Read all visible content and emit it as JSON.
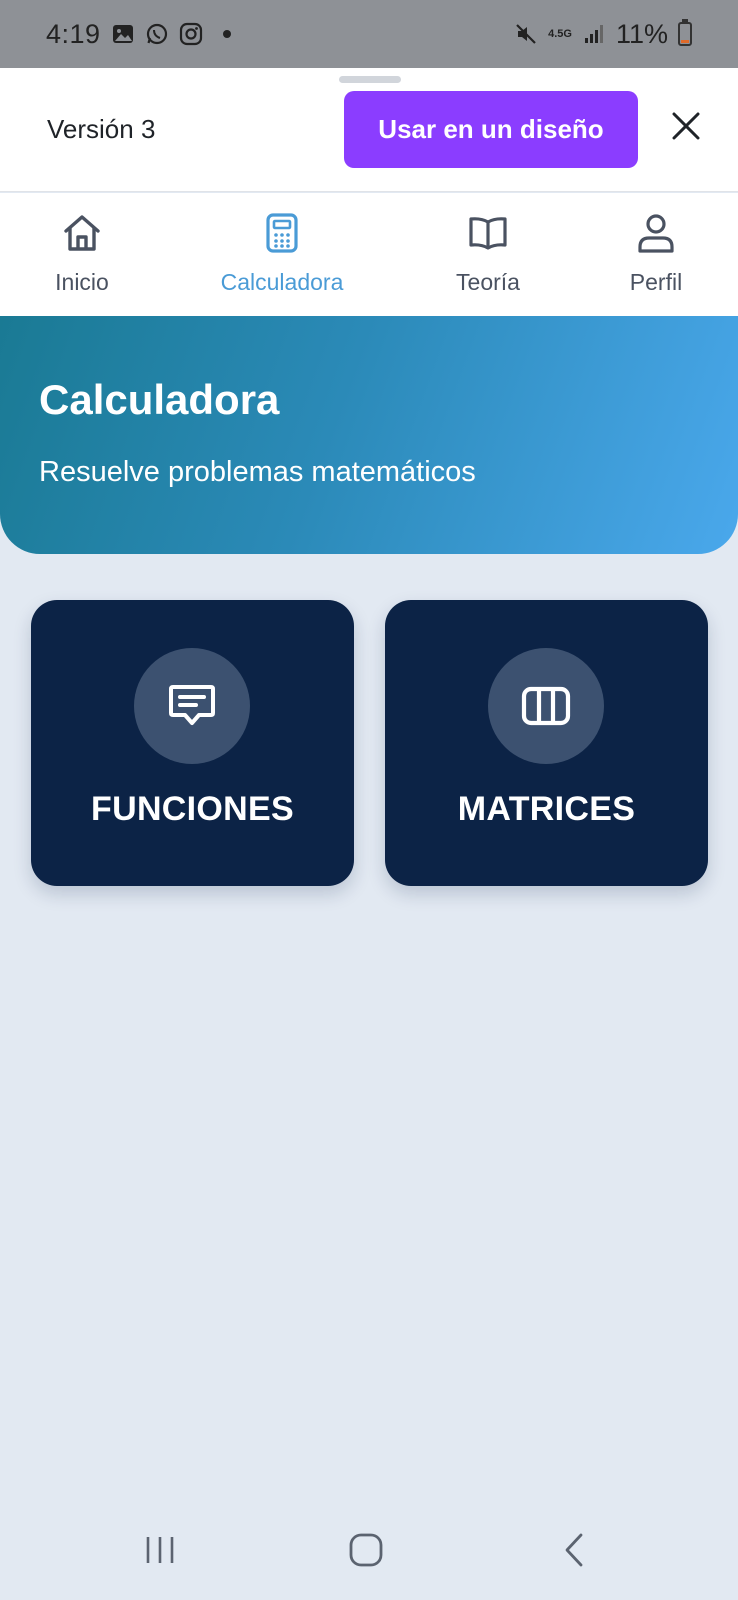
{
  "status_bar": {
    "time": "4:19",
    "network": "4.5G",
    "battery": "11%",
    "icons": [
      "gallery-icon",
      "whatsapp-icon",
      "instagram-icon",
      "notification-dot",
      "mute-icon",
      "signal-icon",
      "battery-icon"
    ]
  },
  "header": {
    "version_label": "Versión 3",
    "use_button_label": "Usar en un diseño",
    "accent_color": "#8b3dff"
  },
  "tabs": [
    {
      "label": "Inicio",
      "icon": "home-icon",
      "active": false
    },
    {
      "label": "Calculadora",
      "icon": "calculator-icon",
      "active": true
    },
    {
      "label": "Teoría",
      "icon": "book-icon",
      "active": false
    },
    {
      "label": "Perfil",
      "icon": "user-icon",
      "active": false
    }
  ],
  "hero": {
    "title": "Calculadora",
    "subtitle": "Resuelve problemas matemáticos"
  },
  "cards": [
    {
      "label": "FUNCIONES",
      "icon": "message-square-text-icon"
    },
    {
      "label": "MATRICES",
      "icon": "columns-icon"
    }
  ],
  "colors": {
    "active_tab": "#4a9bd6",
    "card_bg": "#0c2346",
    "page_bg": "#e2e9f2"
  }
}
